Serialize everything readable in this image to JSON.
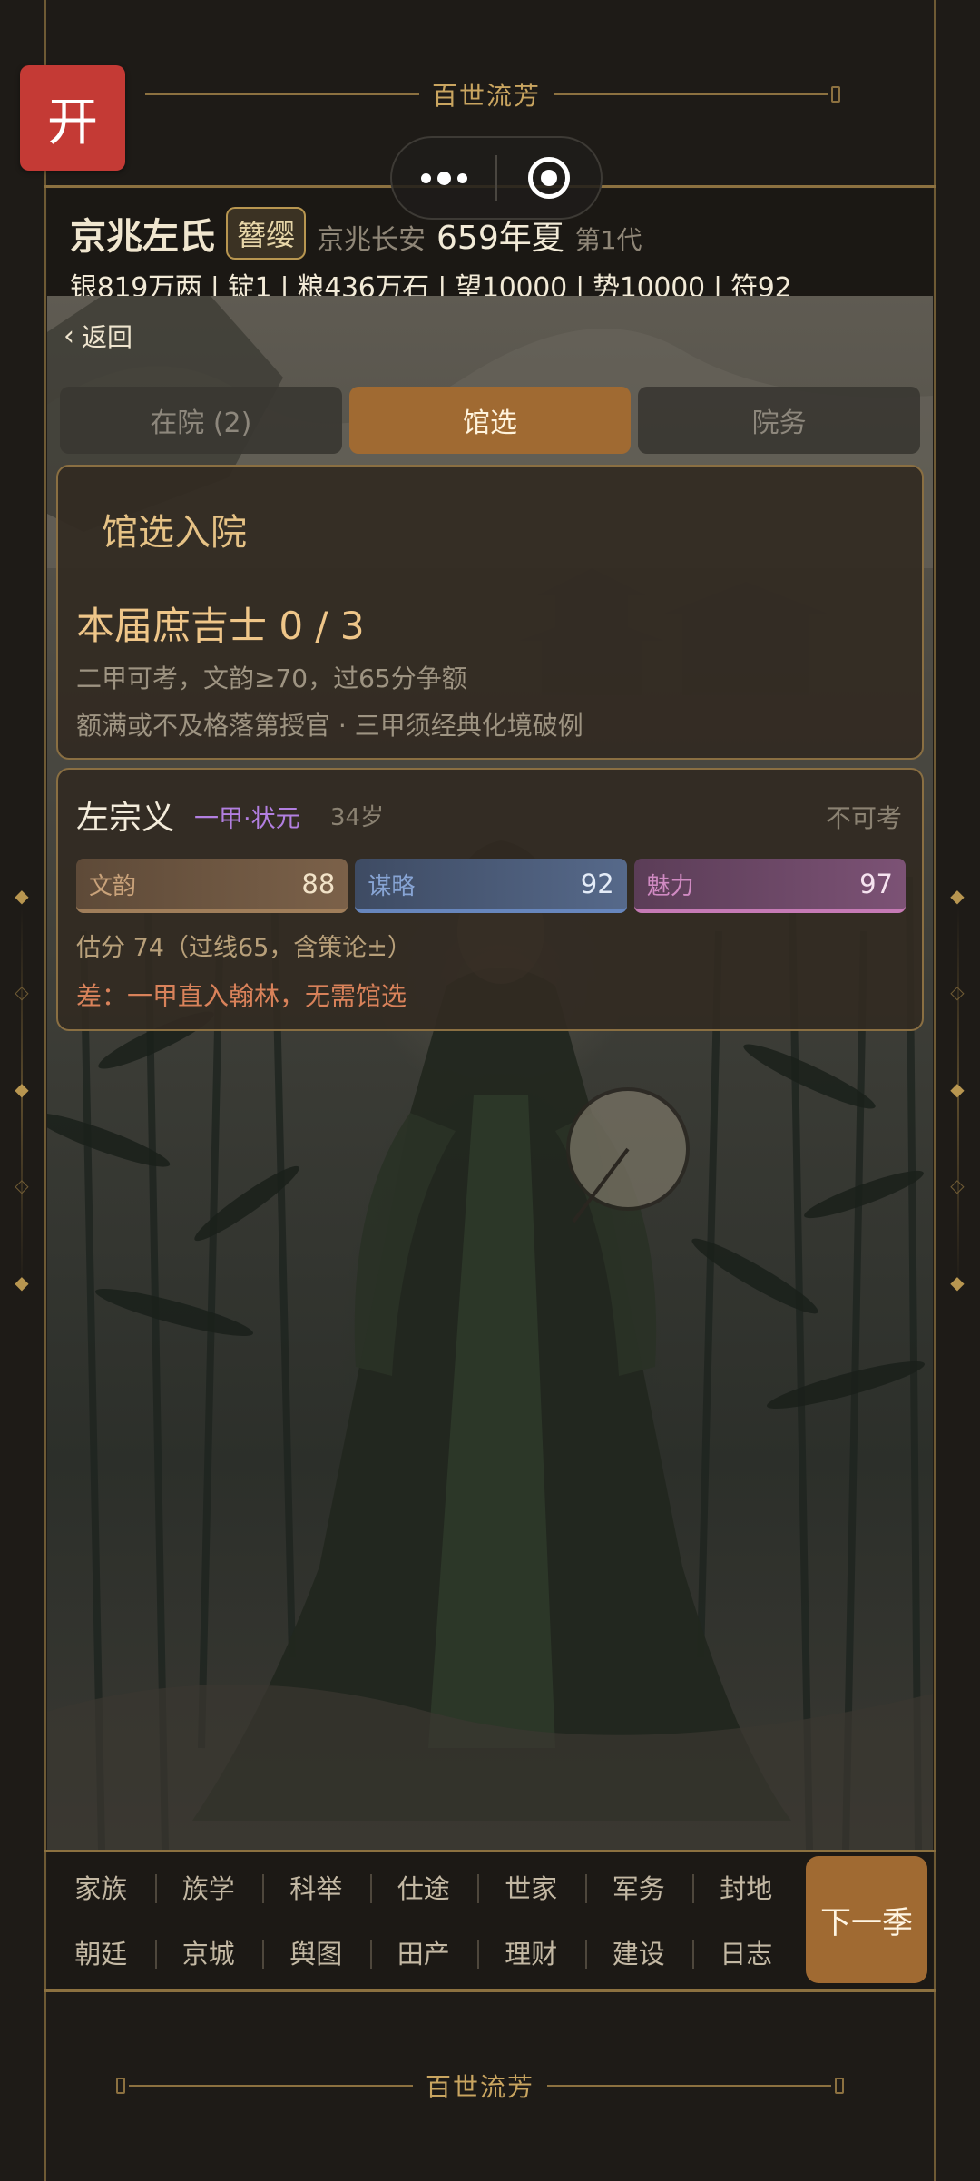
{
  "app": {
    "banner_title": "百世流芳",
    "open_label": "开"
  },
  "status": {
    "clan_name": "京兆左氏",
    "rank_badge": "簪缨",
    "place": "京兆长安",
    "season": "659年夏",
    "generation": "第1代",
    "resources": "银819万两 | 锭1 | 粮436万石 | 望10000 | 势10000 | 符92"
  },
  "nav": {
    "back_label": "返回"
  },
  "tabs": [
    {
      "label": "在院 (2)",
      "active": false
    },
    {
      "label": "馆选",
      "active": true
    },
    {
      "label": "院务",
      "active": false
    }
  ],
  "selection_panel": {
    "title": "馆选入院",
    "count_label": "本届庶吉士  0 / 3",
    "rule_line1": "二甲可考，文韵≥70，过65分争额",
    "rule_line2": "额满或不及格落第授官 · 三甲须经典化境破例"
  },
  "candidate": {
    "name": "左宗义",
    "rank": "一甲·状元",
    "age": "34岁",
    "state": "不可考",
    "stats": [
      {
        "label": "文韵",
        "value": "88"
      },
      {
        "label": "谋略",
        "value": "92"
      },
      {
        "label": "魅力",
        "value": "97"
      }
    ],
    "estimate": "估分 74（过线65，含策论±）",
    "difference": "差：一甲直入翰林，无需馆选"
  },
  "bottom_nav": {
    "row1": [
      "家族",
      "族学",
      "科举",
      "仕途",
      "世家",
      "军务",
      "封地"
    ],
    "row2": [
      "朝廷",
      "京城",
      "舆图",
      "田产",
      "理财",
      "建设",
      "日志"
    ],
    "next_label": "下一季"
  },
  "colors": {
    "accent_gold": "#8c7140",
    "active_tab": "#a06a32",
    "open_button": "#c43a35",
    "rank_purple": "#b27fe0",
    "diff_orange": "#d9825a"
  }
}
